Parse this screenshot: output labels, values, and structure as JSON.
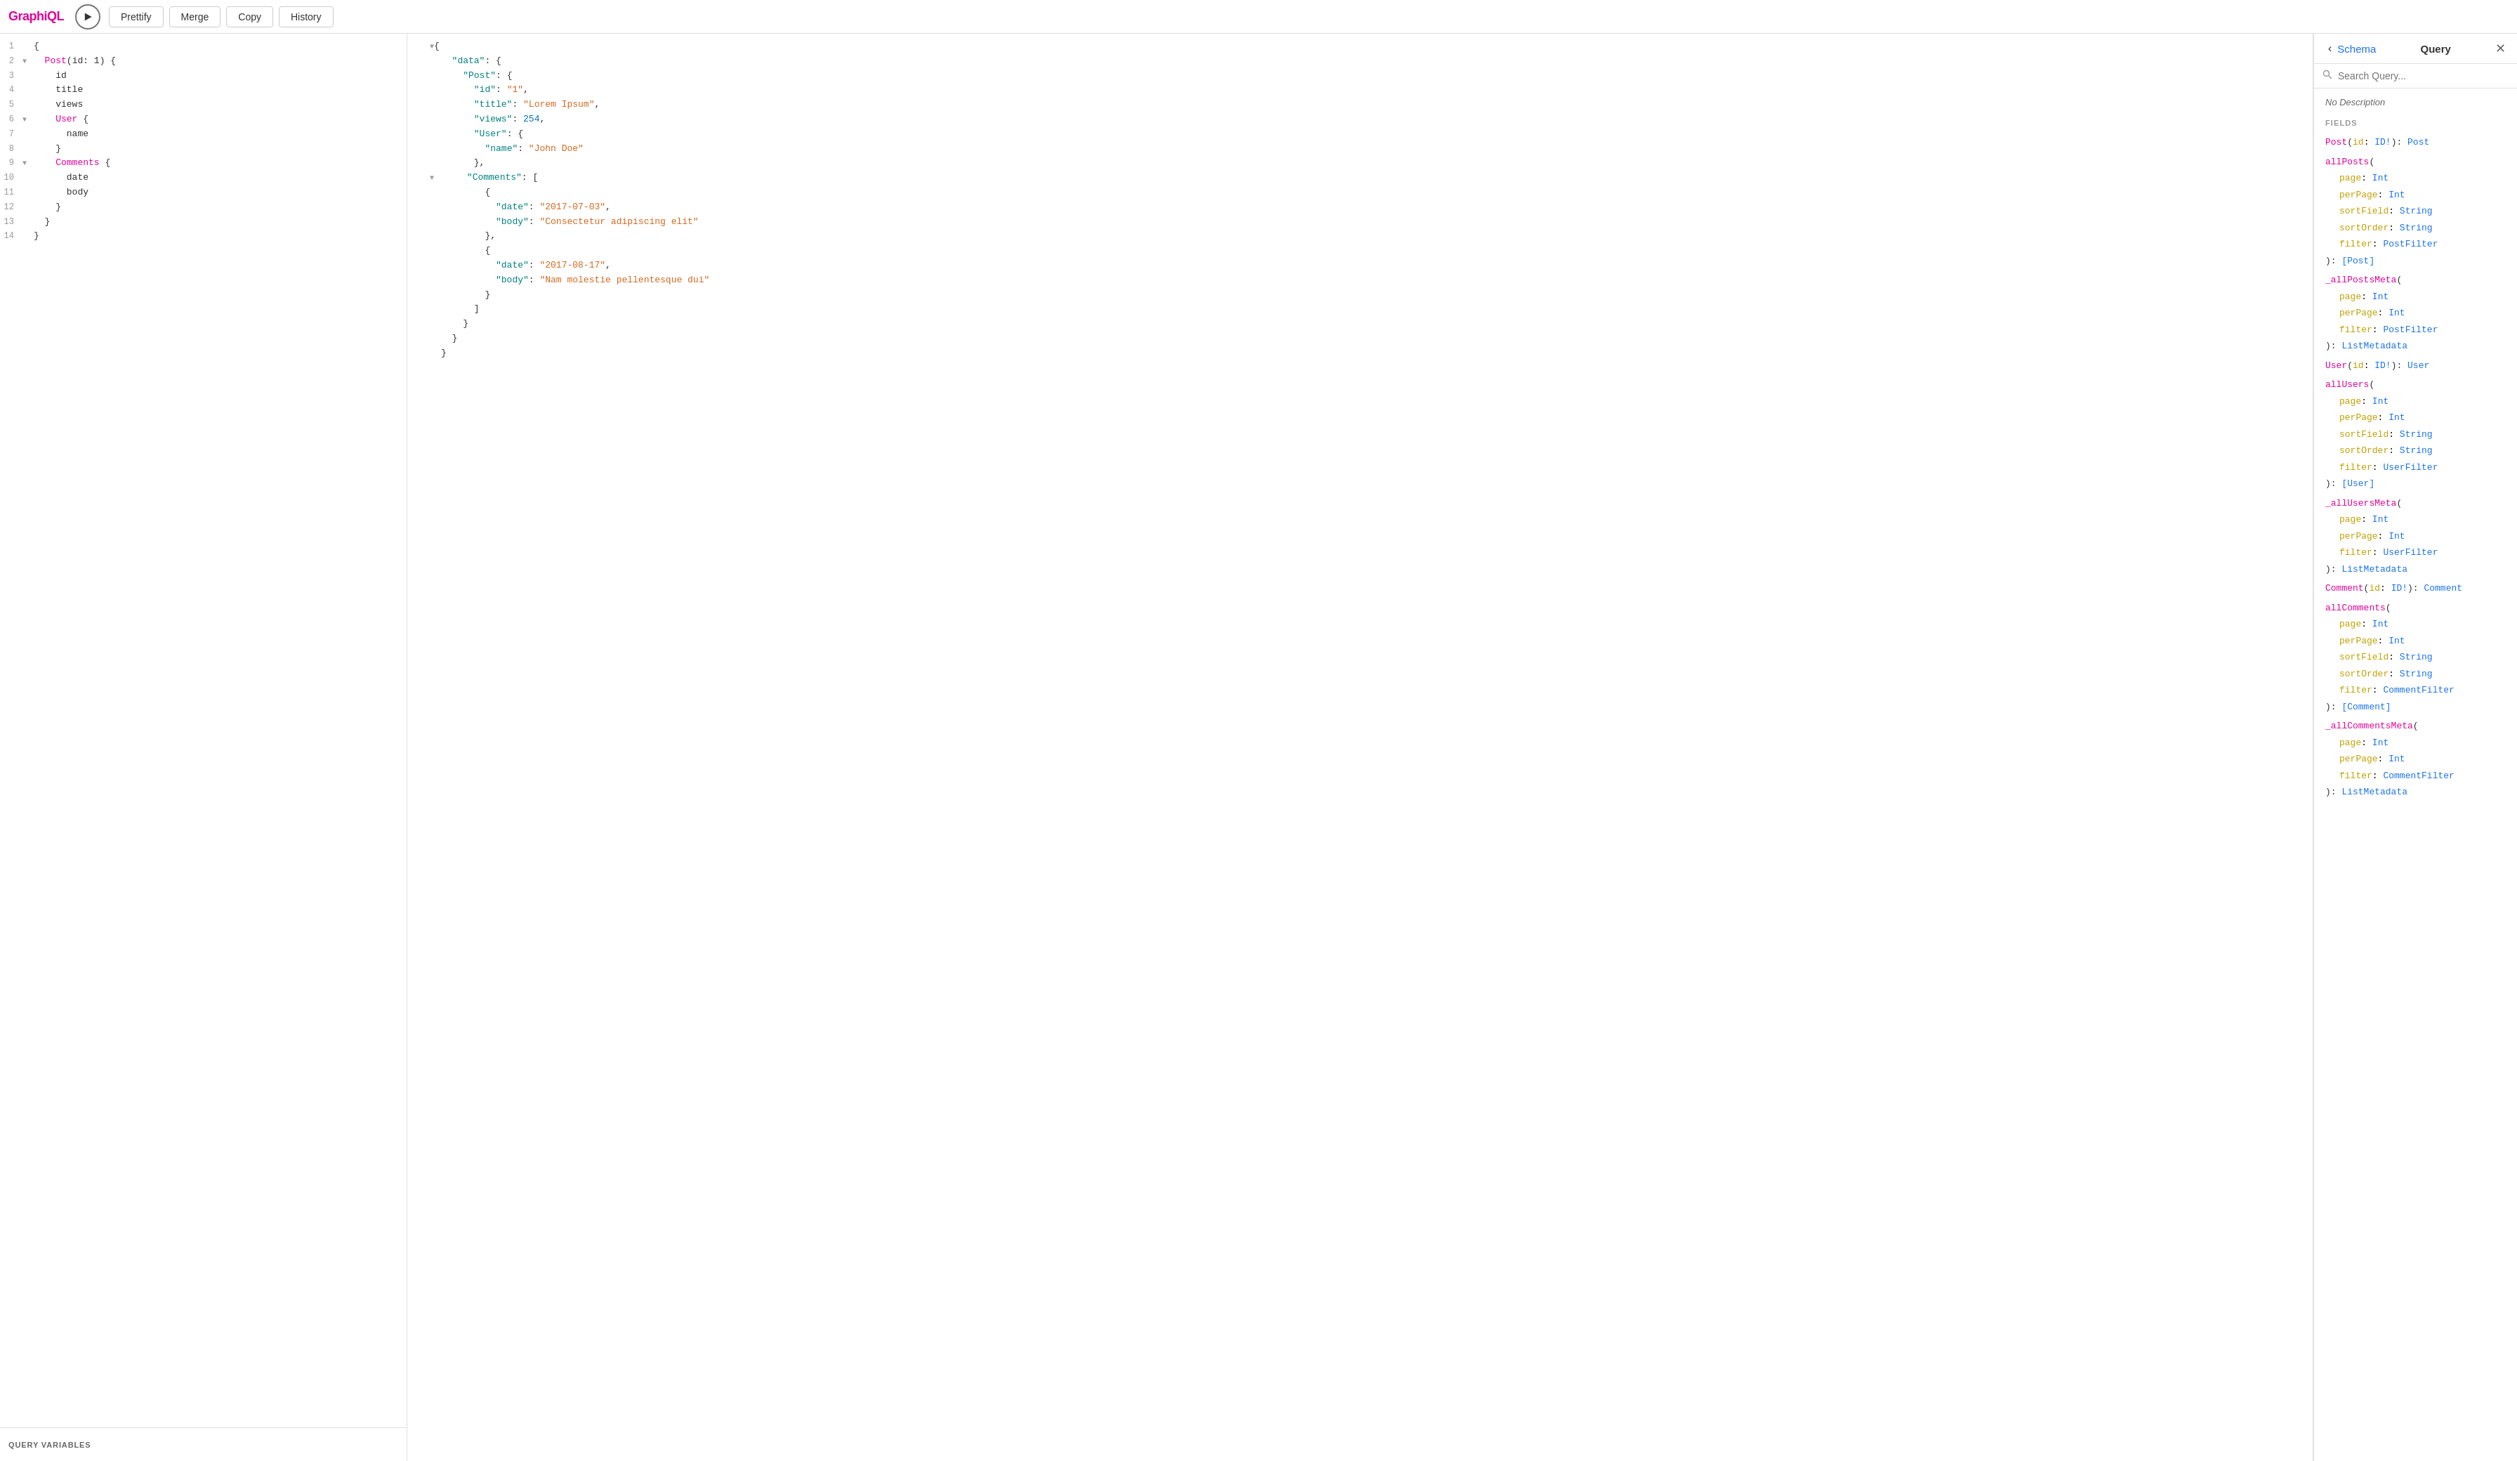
{
  "app": {
    "title": "GraphiQL"
  },
  "toolbar": {
    "run_label": "▶",
    "prettify_label": "Prettify",
    "merge_label": "Merge",
    "copy_label": "Copy",
    "history_label": "History"
  },
  "editor": {
    "lines": [
      {
        "number": 1,
        "toggle": "",
        "content": "{"
      },
      {
        "number": 2,
        "toggle": "▼",
        "content": "  Post(id: 1) {"
      },
      {
        "number": 3,
        "toggle": "",
        "content": "    id"
      },
      {
        "number": 4,
        "toggle": "",
        "content": "    title"
      },
      {
        "number": 5,
        "toggle": "",
        "content": "    views"
      },
      {
        "number": 6,
        "toggle": "▼",
        "content": "    User {"
      },
      {
        "number": 7,
        "toggle": "",
        "content": "      name"
      },
      {
        "number": 8,
        "toggle": "",
        "content": "    }"
      },
      {
        "number": 9,
        "toggle": "▼",
        "content": "    Comments {"
      },
      {
        "number": 10,
        "toggle": "",
        "content": "      date"
      },
      {
        "number": 11,
        "toggle": "",
        "content": "      body"
      },
      {
        "number": 12,
        "toggle": "",
        "content": "    }"
      },
      {
        "number": 13,
        "toggle": "",
        "content": "  }"
      },
      {
        "number": 14,
        "toggle": "",
        "content": "}"
      }
    ],
    "query_variables_label": "QUERY VARIABLES"
  },
  "results": {
    "content": "{\n  \"data\": {\n    \"Post\": {\n      \"id\": \"1\",\n      \"title\": \"Lorem Ipsum\",\n      \"views\": 254,\n      \"User\": {\n        \"name\": \"John Doe\"\n      },\n      \"Comments\": [\n        {\n          \"date\": \"2017-07-03\",\n          \"body\": \"Consectetur adipiscing elit\"\n        },\n        {\n          \"date\": \"2017-08-17\",\n          \"body\": \"Nam molestie pellentesque dui\"\n        }\n      ]\n    }\n  }\n}"
  },
  "schema": {
    "back_label": "‹",
    "schema_label": "Schema",
    "query_label": "Query",
    "close_label": "✕",
    "search_placeholder": "Search Query...",
    "no_description": "No Description",
    "fields_label": "FIELDS",
    "fields": [
      {
        "name": "Post",
        "params": "id: ID!",
        "return_type": "Post",
        "args": []
      },
      {
        "name": "allPosts",
        "params": "",
        "return_type": "[Post]",
        "args": [
          "page: Int",
          "perPage: Int",
          "sortField: String",
          "sortOrder: String",
          "filter: PostFilter"
        ]
      },
      {
        "name": "_allPostsMeta",
        "params": "",
        "return_type": "ListMetadata",
        "args": [
          "page: Int",
          "perPage: Int",
          "filter: PostFilter"
        ]
      },
      {
        "name": "User",
        "params": "id: ID!",
        "return_type": "User",
        "args": []
      },
      {
        "name": "allUsers",
        "params": "",
        "return_type": "[User]",
        "args": [
          "page: Int",
          "perPage: Int",
          "sortField: String",
          "sortOrder: String",
          "filter: UserFilter"
        ]
      },
      {
        "name": "_allUsersMeta",
        "params": "",
        "return_type": "ListMetadata",
        "args": [
          "page: Int",
          "perPage: Int",
          "filter: UserFilter"
        ]
      },
      {
        "name": "Comment",
        "params": "id: ID!",
        "return_type": "Comment",
        "args": []
      },
      {
        "name": "allComments",
        "params": "",
        "return_type": "[Comment]",
        "args": [
          "page: Int",
          "perPage: Int",
          "sortField: String",
          "sortOrder: String",
          "filter: CommentFilter"
        ]
      },
      {
        "name": "_allCommentsMeta",
        "params": "",
        "return_type": "ListMetadata",
        "args": [
          "page: Int",
          "perPage: Int",
          "filter: CommentFilter"
        ]
      }
    ]
  }
}
